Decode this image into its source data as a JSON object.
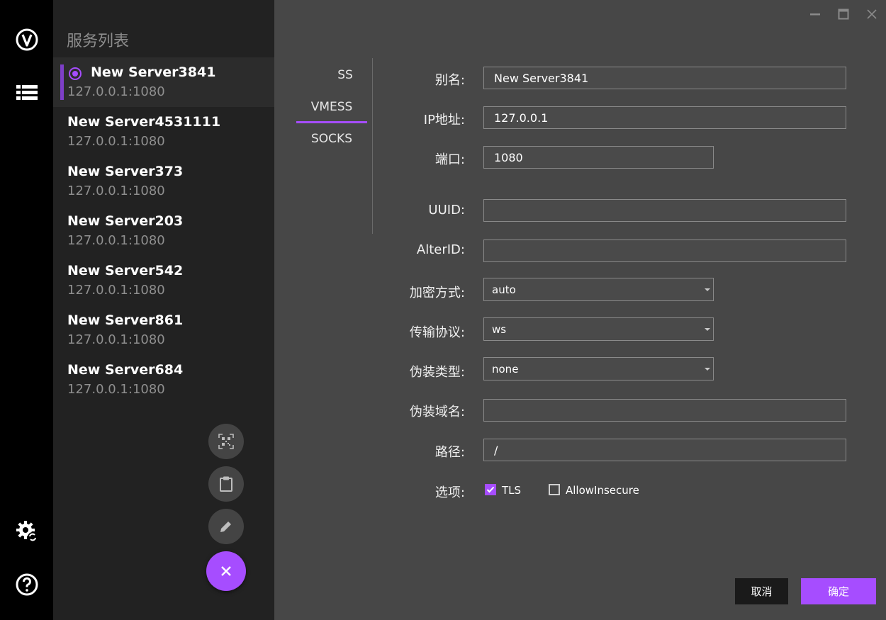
{
  "rail": {
    "icons": [
      "v-logo-icon",
      "list-icon",
      "settings-sync-icon",
      "help-icon"
    ]
  },
  "list": {
    "title": "服务列表",
    "servers": [
      {
        "name": "New Server3841",
        "address": "127.0.0.1:1080",
        "selected": true
      },
      {
        "name": "New Server4531111",
        "address": "127.0.0.1:1080"
      },
      {
        "name": "New Server373",
        "address": "127.0.0.1:1080"
      },
      {
        "name": "New Server203",
        "address": "127.0.0.1:1080"
      },
      {
        "name": "New Server542",
        "address": "127.0.0.1:1080"
      },
      {
        "name": "New Server861",
        "address": "127.0.0.1:1080"
      },
      {
        "name": "New Server684",
        "address": "127.0.0.1:1080"
      }
    ],
    "fabs": [
      "qr-code-icon",
      "clipboard-icon",
      "pencil-icon",
      "close-icon"
    ]
  },
  "window": {
    "controls": [
      "minimize-icon",
      "maximize-icon",
      "close-icon"
    ]
  },
  "tabs": [
    {
      "label": "SS"
    },
    {
      "label": "VMESS",
      "active": true
    },
    {
      "label": "SOCKS"
    }
  ],
  "form": {
    "alias_label": "别名:",
    "alias_value": "New Server3841",
    "ip_label": "IP地址:",
    "ip_value": "127.0.0.1",
    "port_label": "端口:",
    "port_value": "1080",
    "uuid_label": "UUID:",
    "uuid_value": "",
    "alterid_label": "AlterID:",
    "alterid_value": "",
    "encryption_label": "加密方式:",
    "encryption_value": "auto",
    "transport_label": "传输协议:",
    "transport_value": "ws",
    "camouflage_type_label": "伪装类型:",
    "camouflage_type_value": "none",
    "camouflage_domain_label": "伪装域名:",
    "camouflage_domain_value": "",
    "path_label": "路径:",
    "path_value": "/",
    "options_label": "选项:",
    "tls_label": "TLS",
    "tls_checked": true,
    "allow_insecure_label": "AllowInsecure",
    "allow_insecure_checked": false
  },
  "buttons": {
    "cancel": "取消",
    "ok": "确定"
  },
  "colors": {
    "accent": "#a64dff",
    "rail": "#000000",
    "list_bg": "#222222",
    "content_bg": "#474747"
  }
}
